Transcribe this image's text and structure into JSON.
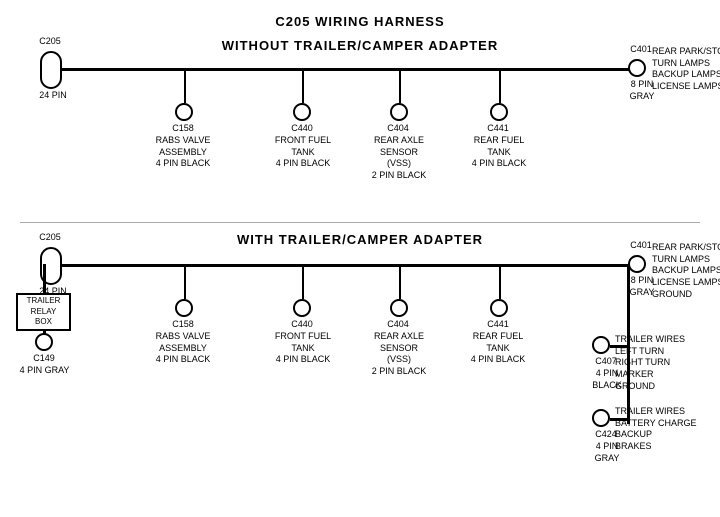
{
  "title": "C205 WIRING HARNESS",
  "top_section": {
    "label": "WITHOUT  TRAILER/CAMPER  ADAPTER",
    "left_connector": {
      "id": "C205",
      "sub": "24 PIN"
    },
    "right_connector": {
      "id": "C401",
      "sub": "8 PIN\nGRAY",
      "label": "REAR PARK/STOP\nTURN LAMPS\nBACKUP LAMPS\nLICENSE LAMPS"
    },
    "connectors": [
      {
        "id": "C158",
        "label": "RABS VALVE\nASSEMBLY\n4 PIN BLACK"
      },
      {
        "id": "C440",
        "label": "FRONT FUEL\nTANK\n4 PIN BLACK"
      },
      {
        "id": "C404",
        "label": "REAR AXLE\nSENSOR\n(VSS)\n2 PIN BLACK"
      },
      {
        "id": "C441",
        "label": "REAR FUEL\nTANK\n4 PIN BLACK"
      }
    ]
  },
  "bottom_section": {
    "label": "WITH  TRAILER/CAMPER  ADAPTER",
    "left_connector": {
      "id": "C205",
      "sub": "24 PIN"
    },
    "right_connector": {
      "id": "C401",
      "sub": "8 PIN\nGRAY",
      "label": "REAR PARK/STOP\nTURN LAMPS\nBACKUP LAMPS\nLICENSE LAMPS\nGROUND"
    },
    "extra_left": {
      "box": "TRAILER\nRELAY\nBOX",
      "id": "C149",
      "sub": "4 PIN GRAY"
    },
    "connectors": [
      {
        "id": "C158",
        "label": "RABS VALVE\nASSEMBLY\n4 PIN BLACK"
      },
      {
        "id": "C440",
        "label": "FRONT FUEL\nTANK\n4 PIN BLACK"
      },
      {
        "id": "C404",
        "label": "REAR AXLE\nSENSOR\n(VSS)\n2 PIN BLACK"
      },
      {
        "id": "C441",
        "label": "REAR FUEL\nTANK\n4 PIN BLACK"
      }
    ],
    "right_extra": [
      {
        "id": "C407",
        "sub": "4 PIN\nBLACK",
        "label": "TRAILER WIRES\nLEFT TURN\nRIGHT TURN\nMARKER\nGROUND"
      },
      {
        "id": "C424",
        "sub": "4 PIN\nGRAY",
        "label": "TRAILER WIRES\nBATTERY CHARGE\nBACKUP\nBRAKES"
      }
    ]
  }
}
